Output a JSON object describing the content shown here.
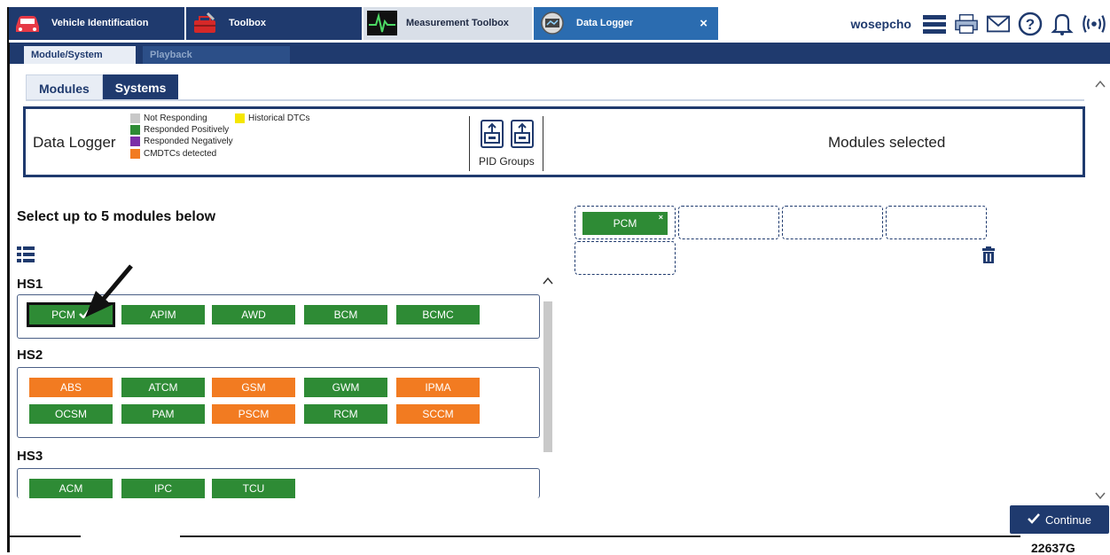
{
  "app_tabs": [
    {
      "label": "Vehicle Identification"
    },
    {
      "label": "Toolbox"
    },
    {
      "label": "Measurement Toolbox"
    },
    {
      "label": "Data Logger",
      "close": "×"
    }
  ],
  "user": {
    "name": "wosepcho"
  },
  "sub_tabs": [
    {
      "label": "Module/System"
    },
    {
      "label": "Playback"
    }
  ],
  "main_tabs": [
    {
      "label": "Modules"
    },
    {
      "label": "Systems"
    }
  ],
  "info": {
    "title": "Data Logger",
    "legend": [
      {
        "label": "Not Responding",
        "color": "#c8c8c8"
      },
      {
        "label": "Responded Positively",
        "color": "#2e8b35"
      },
      {
        "label": "Responded Negatively",
        "color": "#7b2fa8"
      },
      {
        "label": "CMDTCs detected",
        "color": "#f27b21"
      },
      {
        "label": "Historical DTCs",
        "color": "#f5e600"
      }
    ],
    "pid_label": "PID Groups",
    "modules_selected": "Modules selected"
  },
  "select_heading": "Select up to 5 modules below",
  "groups": [
    {
      "name": "HS1",
      "modules": [
        {
          "label": "PCM",
          "status": "green",
          "selected": true
        },
        {
          "label": "APIM",
          "status": "green"
        },
        {
          "label": "AWD",
          "status": "green"
        },
        {
          "label": "BCM",
          "status": "green"
        },
        {
          "label": "BCMC",
          "status": "green"
        }
      ]
    },
    {
      "name": "HS2",
      "modules": [
        {
          "label": "ABS",
          "status": "orange"
        },
        {
          "label": "ATCM",
          "status": "green"
        },
        {
          "label": "GSM",
          "status": "orange"
        },
        {
          "label": "GWM",
          "status": "green"
        },
        {
          "label": "IPMA",
          "status": "orange"
        },
        {
          "label": "OCSM",
          "status": "green"
        },
        {
          "label": "PAM",
          "status": "green"
        },
        {
          "label": "PSCM",
          "status": "orange"
        },
        {
          "label": "RCM",
          "status": "green"
        },
        {
          "label": "SCCM",
          "status": "orange"
        }
      ]
    },
    {
      "name": "HS3",
      "modules": [
        {
          "label": "ACM",
          "status": "green"
        },
        {
          "label": "IPC",
          "status": "green"
        },
        {
          "label": "TCU",
          "status": "green"
        }
      ]
    }
  ],
  "slots": {
    "filled": "PCM",
    "remove": "×"
  },
  "continue_label": "Continue",
  "figure_id": "22637G"
}
